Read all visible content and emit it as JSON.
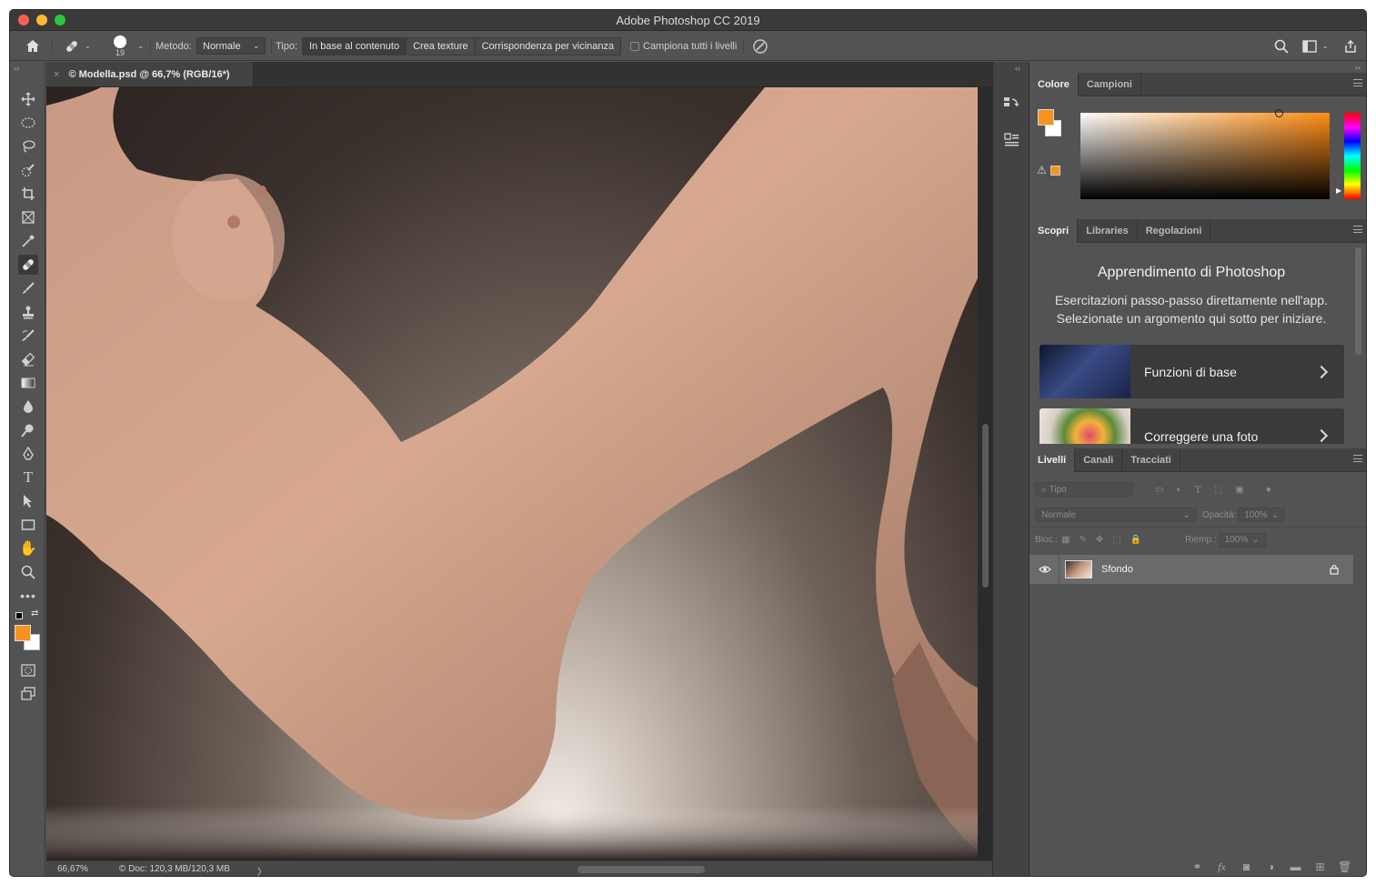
{
  "window": {
    "title": "Adobe Photoshop CC 2019",
    "traffic_lights": [
      "close",
      "minimize",
      "maximize"
    ]
  },
  "options_bar": {
    "home_icon": "home-icon",
    "tool_icon": "healing-brush-icon",
    "brush_size": "19",
    "metodo_label": "Metodo:",
    "metodo_value": "Normale",
    "tipo_label": "Tipo:",
    "tipo_options": [
      "In base al contenuto",
      "Crea texture",
      "Corrispondenza per vicinanza"
    ],
    "tipo_active": "In base al contenuto",
    "sample_all_label": "Campiona tutti i livelli",
    "sample_all_checked": false,
    "right_icons": [
      "search-icon",
      "workspace-icon",
      "share-icon"
    ]
  },
  "document": {
    "tab_title": "© Modella.psd @ 66,7% (RGB/16*)",
    "close_glyph": "×",
    "zoom": "66,67%",
    "doc_info": "© Doc: 120,3 MB/120,3 MB",
    "status_arrow": "〉"
  },
  "tools": [
    "move-tool",
    "marquee-tool",
    "lasso-tool",
    "quick-selection-tool",
    "crop-tool",
    "frame-tool",
    "eyedropper-tool",
    "healing-brush-tool",
    "brush-tool",
    "clone-stamp-tool",
    "history-brush-tool",
    "eraser-tool",
    "gradient-tool",
    "blur-tool",
    "dodge-tool",
    "pen-tool",
    "type-tool",
    "path-selection-tool",
    "rectangle-tool",
    "hand-tool",
    "zoom-tool",
    "more-tools"
  ],
  "colors": {
    "foreground": "#f7931e",
    "background": "#ffffff",
    "accent": "#f7931e"
  },
  "color_panel": {
    "tabs": [
      "Colore",
      "Campioni"
    ],
    "active_tab": "Colore"
  },
  "learn_panel": {
    "tabs": [
      "Scopri",
      "Libraries",
      "Regolazioni"
    ],
    "active_tab": "Scopri",
    "title": "Apprendimento di Photoshop",
    "description_line1": "Esercitazioni passo-passo direttamente nell'app.",
    "description_line2": "Selezionate un argomento qui sotto per iniziare.",
    "cards": [
      {
        "label": "Funzioni di base"
      },
      {
        "label": "Correggere una foto"
      }
    ]
  },
  "layers_panel": {
    "tabs": [
      "Livelli",
      "Canali",
      "Tracciati"
    ],
    "active_tab": "Livelli",
    "filter_placeholder": "Tipo",
    "blend_mode": "Normale",
    "opacity_label": "Opacità:",
    "opacity_value": "100%",
    "lock_label": "Bloc.:",
    "fill_label": "Riemp.:",
    "fill_value": "100%",
    "layers": [
      {
        "name": "Sfondo",
        "visible": true,
        "locked": true
      }
    ],
    "bottom_icons": [
      "link-icon",
      "fx-icon",
      "mask-icon",
      "adjustment-icon",
      "folder-icon",
      "new-layer-icon",
      "trash-icon"
    ],
    "fx_text": "fx"
  }
}
